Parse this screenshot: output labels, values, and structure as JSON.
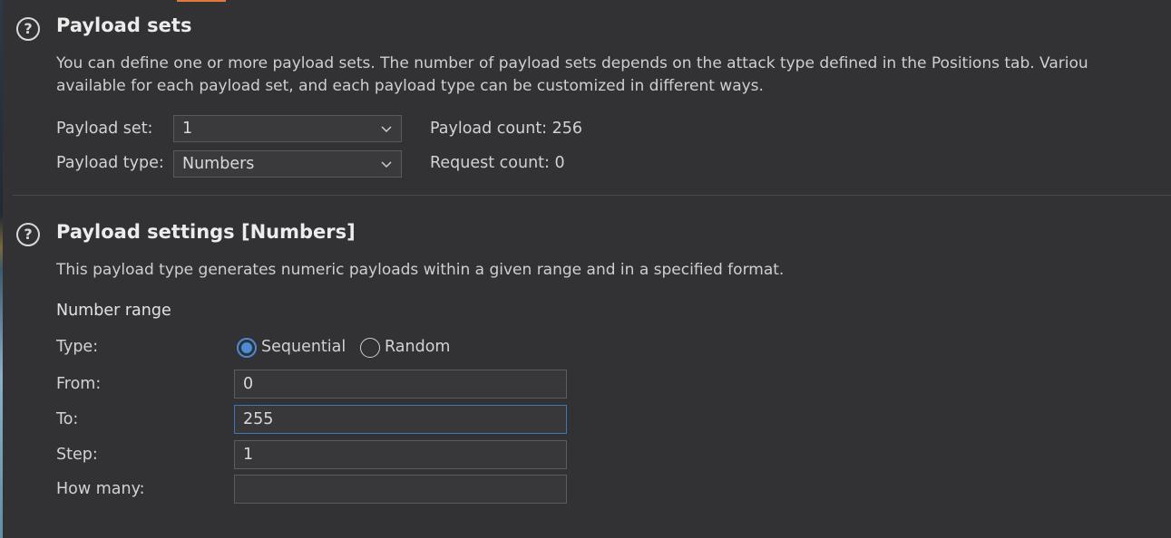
{
  "payload_sets": {
    "title": "Payload sets",
    "description_line1": "You can define one or more payload sets. The number of payload sets depends on the attack type defined in the Positions tab. Variou",
    "description_line2": "available for each payload set, and each payload type can be customized in different ways.",
    "payload_set_label": "Payload set:",
    "payload_set_value": "1",
    "payload_type_label": "Payload type:",
    "payload_type_value": "Numbers",
    "payload_count_label": "Payload count: 256",
    "request_count_label": "Request count: 0"
  },
  "payload_settings": {
    "title": "Payload settings [Numbers]",
    "description": "This payload type generates numeric payloads within a given range and in a specified format.",
    "number_range_heading": "Number range",
    "type_label": "Type:",
    "type_options": [
      "Sequential",
      "Random"
    ],
    "type_selected": "Sequential",
    "from_label": "From:",
    "from_value": "0",
    "to_label": "To:",
    "to_value": "255",
    "step_label": "Step:",
    "step_value": "1",
    "how_many_label": "How many:",
    "how_many_value": ""
  },
  "icons": {
    "help": "help-circle-icon",
    "dropdown": "chevron-down-icon"
  },
  "colors": {
    "background": "#323235",
    "accent": "#4a8cd6",
    "focus_border": "#3f77b5",
    "top_accent": "#e0793a"
  }
}
